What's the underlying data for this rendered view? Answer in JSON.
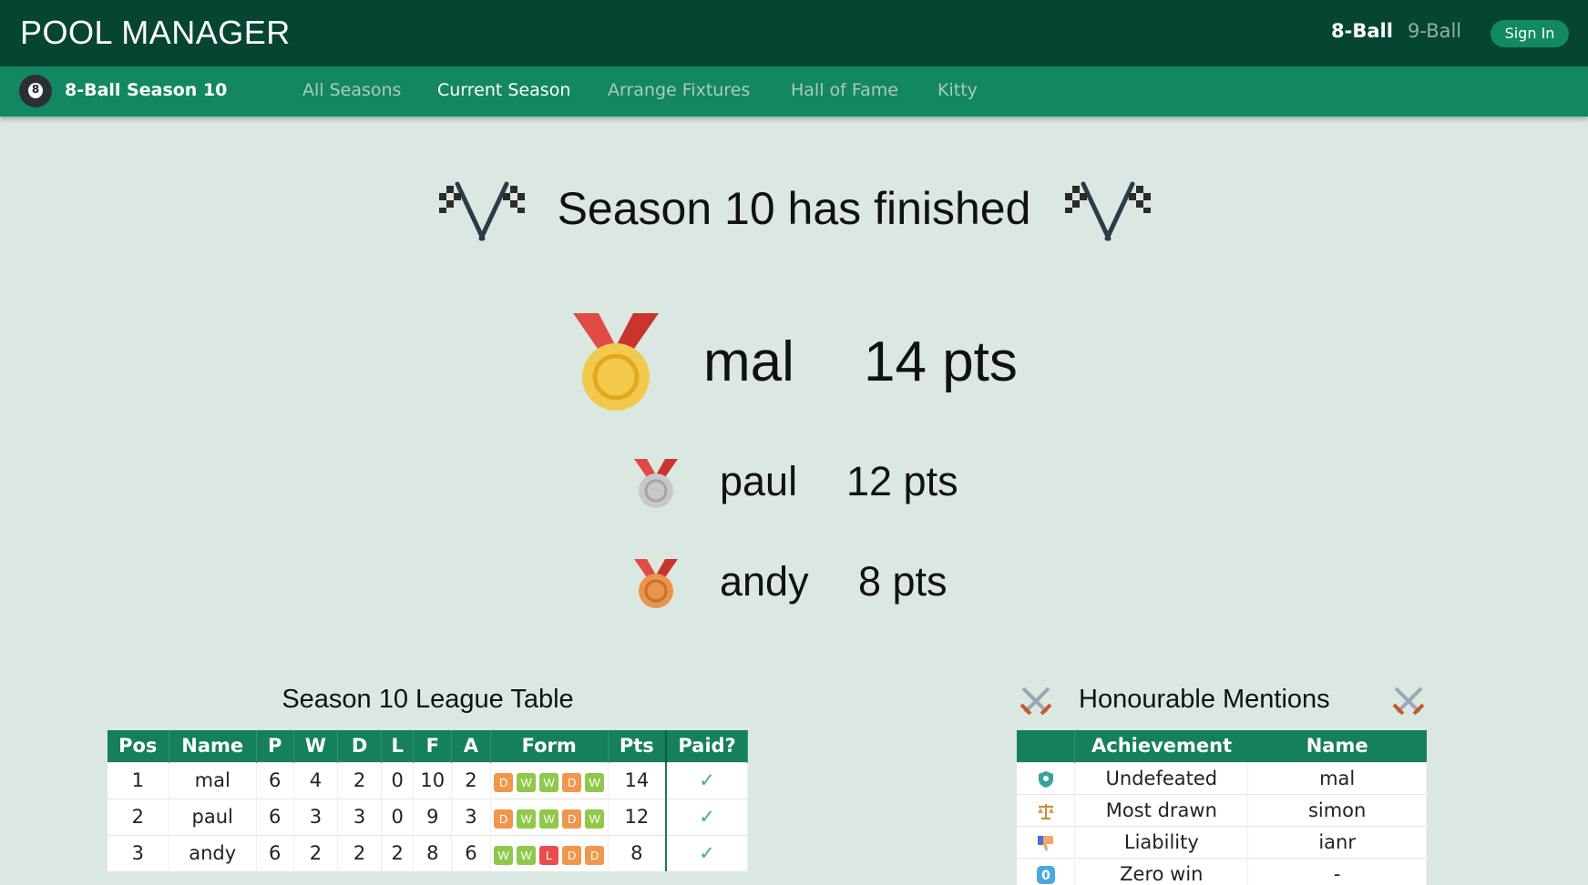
{
  "header": {
    "brand": "POOL MANAGER",
    "games": [
      "8-Ball",
      "9-Ball"
    ],
    "sign_in": "Sign In"
  },
  "subnav": {
    "ball_number": "8",
    "season": "8-Ball Season 10",
    "items": [
      "All Seasons",
      "Current Season",
      "Arrange Fixtures",
      "Hall of Fame",
      "Kitty"
    ]
  },
  "headline": "Season 10 has finished",
  "podium": [
    {
      "name": "mal",
      "pts": "14 pts",
      "medal": "gold-medal-icon"
    },
    {
      "name": "paul",
      "pts": "12 pts",
      "medal": "silver-medal-icon"
    },
    {
      "name": "andy",
      "pts": "8 pts",
      "medal": "bronze-medal-icon"
    }
  ],
  "league": {
    "title": "Season 10 League Table",
    "headers": [
      "Pos",
      "Name",
      "P",
      "W",
      "D",
      "L",
      "F",
      "A",
      "Form",
      "Pts",
      "Paid?"
    ],
    "rows": [
      {
        "pos": "1",
        "name": "mal",
        "p": "6",
        "w": "4",
        "d": "2",
        "l": "0",
        "f": "10",
        "a": "2",
        "form": [
          "D",
          "W",
          "W",
          "D",
          "W"
        ],
        "pts": "14",
        "paid": "✓"
      },
      {
        "pos": "2",
        "name": "paul",
        "p": "6",
        "w": "3",
        "d": "3",
        "l": "0",
        "f": "9",
        "a": "3",
        "form": [
          "D",
          "W",
          "W",
          "D",
          "W"
        ],
        "pts": "12",
        "paid": "✓"
      },
      {
        "pos": "3",
        "name": "andy",
        "p": "6",
        "w": "2",
        "d": "2",
        "l": "2",
        "f": "8",
        "a": "6",
        "form": [
          "W",
          "W",
          "L",
          "D",
          "D"
        ],
        "pts": "8",
        "paid": "✓"
      }
    ]
  },
  "mentions": {
    "title": "Honourable Mentions",
    "headers": [
      "",
      "Achievement",
      "Name"
    ],
    "rows": [
      {
        "icon": "shield-icon",
        "achievement": "Undefeated",
        "name": "mal"
      },
      {
        "icon": "scales-icon",
        "achievement": "Most drawn",
        "name": "simon"
      },
      {
        "icon": "thumbs-down-icon",
        "achievement": "Liability",
        "name": "ianr"
      },
      {
        "icon": "zero-icon",
        "achievement": "Zero win",
        "name": "-"
      }
    ]
  },
  "colors": {
    "topbar": "#054531",
    "subnav": "#138760",
    "background": "#dbe8e1",
    "win": "#8fc84b",
    "draw": "#f0974d",
    "loss": "#ea4d4d"
  }
}
